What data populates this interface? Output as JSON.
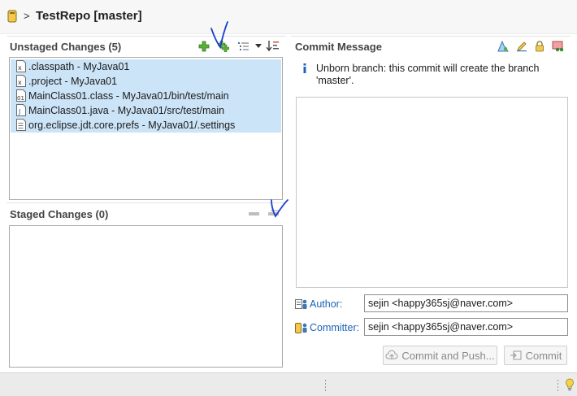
{
  "header": {
    "chevron": ">",
    "title": "TestRepo [master]"
  },
  "unstaged": {
    "title": "Unstaged Changes (5)",
    "files": [
      {
        "label": ".classpath - MyJava01",
        "icon": "file-x-icon"
      },
      {
        "label": ".project - MyJava01",
        "icon": "file-x-icon"
      },
      {
        "label": "MainClass01.class - MyJava01/bin/test/main",
        "icon": "class-file-icon"
      },
      {
        "label": "MainClass01.java - MyJava01/src/test/main",
        "icon": "java-file-icon"
      },
      {
        "label": "org.eclipse.jdt.core.prefs - MyJava01/.settings",
        "icon": "text-file-icon"
      }
    ],
    "toolbar": [
      "add-to-index-icon",
      "add-all-to-index-icon",
      "presentation-icon",
      "dropdown-icon",
      "sort-icon"
    ]
  },
  "staged": {
    "title": "Staged Changes (0)",
    "toolbar": [
      "remove-from-index-icon",
      "remove-all-from-index-icon"
    ]
  },
  "commit": {
    "title": "Commit Message",
    "info": "Unborn branch: this commit will create the branch 'master'.",
    "author_label": "Author:",
    "author_value": "sejin <happy365sj@naver.com>",
    "committer_label": "Committer:",
    "committer_value": "sejin <happy365sj@naver.com>",
    "commit_push_label": "Commit and Push...",
    "commit_label": "Commit",
    "toolbar": [
      "signed-off-icon",
      "amend-icon",
      "sign-commit-icon",
      "change-id-icon"
    ]
  },
  "colors": {
    "selection": "#cce4f7",
    "link": "#1c63b7",
    "check_mark": "#1a3fd0"
  }
}
